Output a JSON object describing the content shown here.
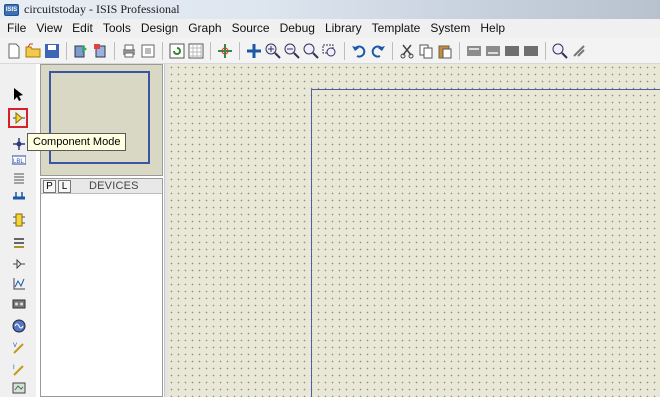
{
  "window": {
    "logo_text": "ISIS",
    "title": "circuitstoday - ISIS Professional"
  },
  "menu": {
    "items": [
      "File",
      "View",
      "Edit",
      "Tools",
      "Design",
      "Graph",
      "Source",
      "Debug",
      "Library",
      "Template",
      "System",
      "Help"
    ]
  },
  "toolbar": {
    "icons": [
      "new-file-icon",
      "open-folder-icon",
      "save-icon",
      "import-icon",
      "export-icon",
      "print-icon",
      "print-area-icon",
      "refresh-icon",
      "grid-icon",
      "origin-icon",
      "pan-icon",
      "zoom-in-icon",
      "zoom-out-icon",
      "zoom-all-icon",
      "zoom-area-icon",
      "undo-icon",
      "redo-icon",
      "cut-icon",
      "copy-icon",
      "paste-icon",
      "block-copy-icon",
      "block-move-icon",
      "block-rotate-icon",
      "block-delete-icon",
      "pick-device-icon",
      "make-device-icon"
    ]
  },
  "leftstrip": {
    "tools": [
      "selection-mode-icon",
      "component-mode-icon",
      "junction-dot-icon",
      "wire-label-icon",
      "text-script-icon",
      "buses-icon",
      "subcircuit-icon",
      "terminals-icon",
      "device-pins-icon",
      "graph-mode-icon",
      "tape-recorder-icon",
      "generator-icon",
      "voltage-probe-icon",
      "current-probe-icon",
      "virtual-instruments-icon"
    ],
    "tooltip": "Component Mode"
  },
  "devices": {
    "p_label": "P",
    "l_label": "L",
    "title": "DEVICES"
  },
  "colors": {
    "canvas": "#e9e8d6",
    "sheet_border": "#4d5ea8",
    "highlight": "#d6212a",
    "tooltip_bg": "#ffffe1"
  }
}
